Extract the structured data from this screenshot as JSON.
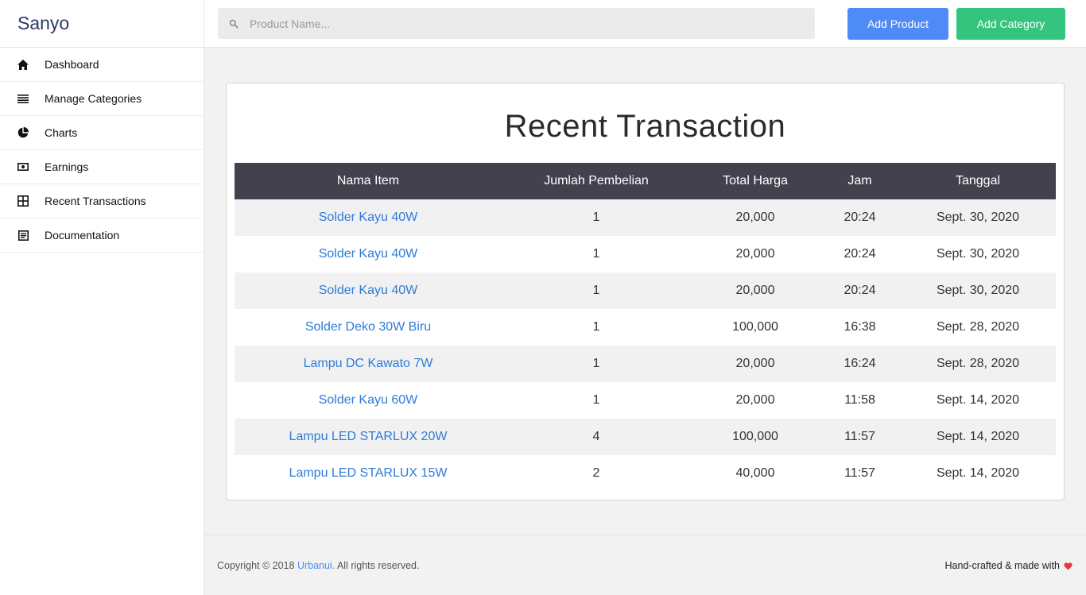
{
  "brand": "Sanyo",
  "sidebar": {
    "items": [
      {
        "label": "Dashboard",
        "icon": "home-icon"
      },
      {
        "label": "Manage Categories",
        "icon": "list-icon"
      },
      {
        "label": "Charts",
        "icon": "pie-chart-icon"
      },
      {
        "label": "Earnings",
        "icon": "money-icon"
      },
      {
        "label": "Recent Transactions",
        "icon": "grid-icon"
      },
      {
        "label": "Documentation",
        "icon": "document-icon"
      }
    ]
  },
  "search": {
    "placeholder": "Product Name...",
    "value": ""
  },
  "toolbar": {
    "add_product": "Add Product",
    "add_category": "Add Category",
    "add_product_color": "#4e8bf6",
    "add_category_color": "#35c47d"
  },
  "main": {
    "title": "Recent Transaction",
    "columns": [
      "Nama Item",
      "Jumlah Pembelian",
      "Total Harga",
      "Jam",
      "Tanggal"
    ],
    "rows": [
      [
        "Solder Kayu 40W",
        "1",
        "20,000",
        "20:24",
        "Sept. 30, 2020"
      ],
      [
        "Solder Kayu 40W",
        "1",
        "20,000",
        "20:24",
        "Sept. 30, 2020"
      ],
      [
        "Solder Kayu 40W",
        "1",
        "20,000",
        "20:24",
        "Sept. 30, 2020"
      ],
      [
        "Solder Deko 30W Biru",
        "1",
        "100,000",
        "16:38",
        "Sept. 28, 2020"
      ],
      [
        "Lampu DC Kawato 7W",
        "1",
        "20,000",
        "16:24",
        "Sept. 28, 2020"
      ],
      [
        "Solder Kayu 60W",
        "1",
        "20,000",
        "11:58",
        "Sept. 14, 2020"
      ],
      [
        "Lampu LED STARLUX 20W",
        "4",
        "100,000",
        "11:57",
        "Sept. 14, 2020"
      ],
      [
        "Lampu LED STARLUX 15W",
        "2",
        "40,000",
        "11:57",
        "Sept. 14, 2020"
      ]
    ]
  },
  "footer": {
    "copyright_prefix": "Copyright © 2018 ",
    "copyright_link": "Urbanui.",
    "copyright_suffix": " All rights reserved.",
    "crafted": "Hand-crafted & made with",
    "heart_color": "#e8353e"
  }
}
